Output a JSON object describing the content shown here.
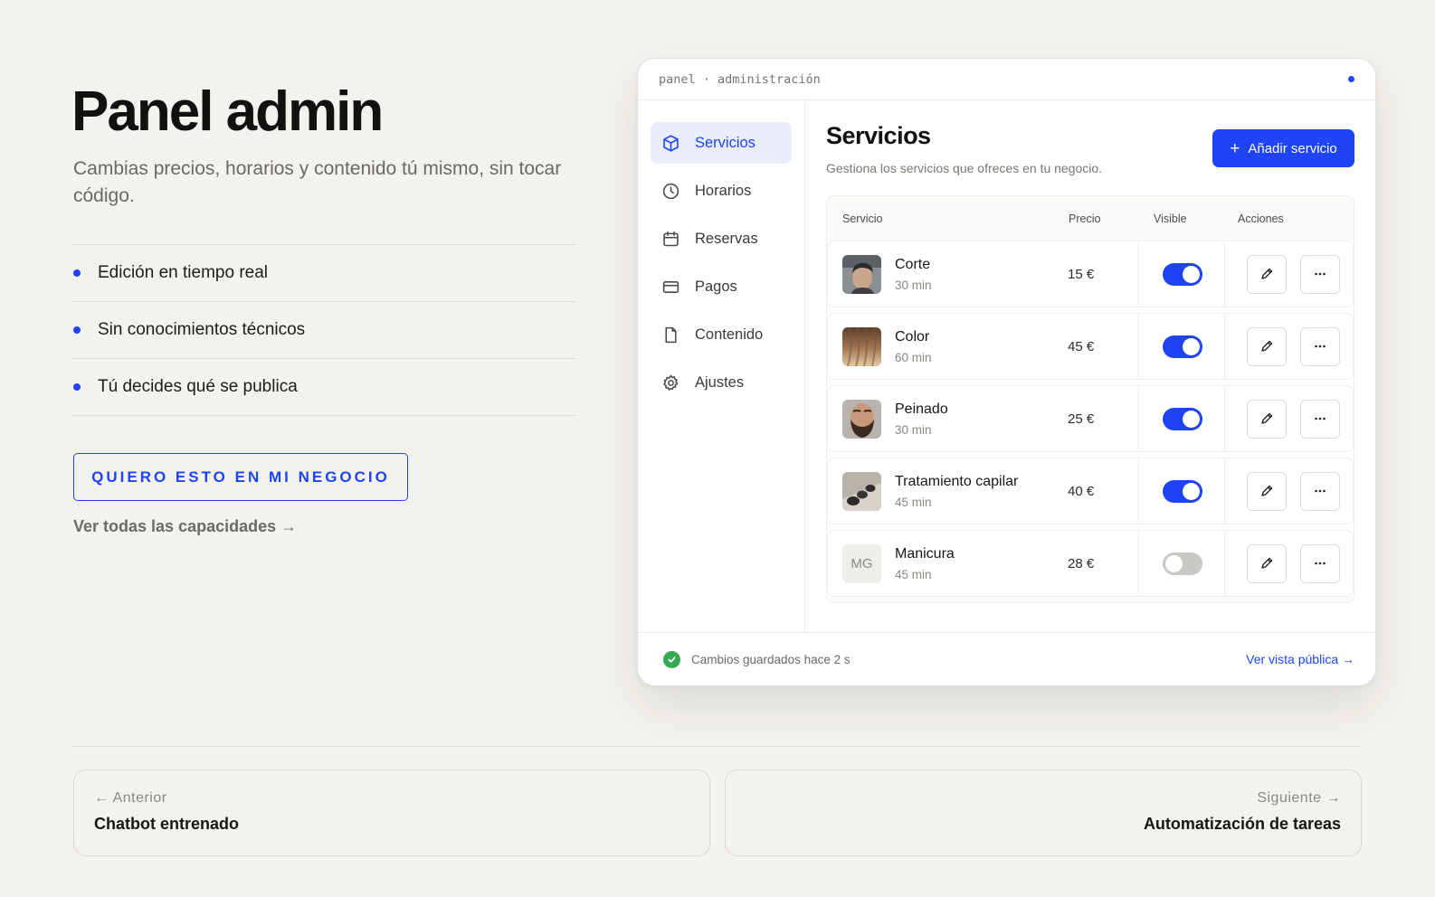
{
  "hero": {
    "title": "Panel admin",
    "subtitle": "Cambias precios, horarios y contenido tú mismo, sin tocar código.",
    "features": [
      "Edición en tiempo real",
      "Sin conocimientos técnicos",
      "Tú decides qué se publica"
    ],
    "cta_label": "QUIERO ESTO EN MI NEGOCIO",
    "link_label": "Ver todas las capacidades →"
  },
  "window": {
    "titlebar": "panel · administración",
    "sidebar": [
      {
        "label": "Servicios",
        "icon": "box-icon",
        "active": true
      },
      {
        "label": "Horarios",
        "icon": "clock-icon",
        "active": false
      },
      {
        "label": "Reservas",
        "icon": "calendar-icon",
        "active": false
      },
      {
        "label": "Pagos",
        "icon": "card-icon",
        "active": false
      },
      {
        "label": "Contenido",
        "icon": "document-icon",
        "active": false
      },
      {
        "label": "Ajustes",
        "icon": "gear-icon",
        "active": false
      }
    ],
    "main": {
      "title": "Servicios",
      "description": "Gestiona los servicios que ofreces en tu negocio.",
      "add_button": "Añadir servicio",
      "columns": [
        "Servicio",
        "Precio",
        "Visible",
        "Acciones"
      ],
      "rows": [
        {
          "name": "Corte",
          "duration": "30 min",
          "price": "15 €",
          "visible": true,
          "thumb": "haircut-photo"
        },
        {
          "name": "Color",
          "duration": "60 min",
          "price": "45 €",
          "visible": true,
          "thumb": "hair-color-photo"
        },
        {
          "name": "Peinado",
          "duration": "30 min",
          "price": "25 €",
          "visible": true,
          "thumb": "beard-photo"
        },
        {
          "name": "Tratamiento capilar",
          "duration": "45 min",
          "price": "40 €",
          "visible": true,
          "thumb": "stones-photo"
        },
        {
          "name": "Manicura",
          "duration": "45 min",
          "price": "28 €",
          "visible": false,
          "thumb": "MG"
        }
      ]
    },
    "footer": {
      "status": "Cambios guardados hace 2 s",
      "public_link": "Ver vista pública →"
    }
  },
  "pagination": {
    "prev_small": "← Anterior",
    "prev_title": "Chatbot entrenado",
    "next_small": "Siguiente →",
    "next_title": "Automatización de tareas"
  },
  "colors": {
    "accent": "#1f44f5",
    "background": "#f4f2ec",
    "success": "#34a853"
  }
}
